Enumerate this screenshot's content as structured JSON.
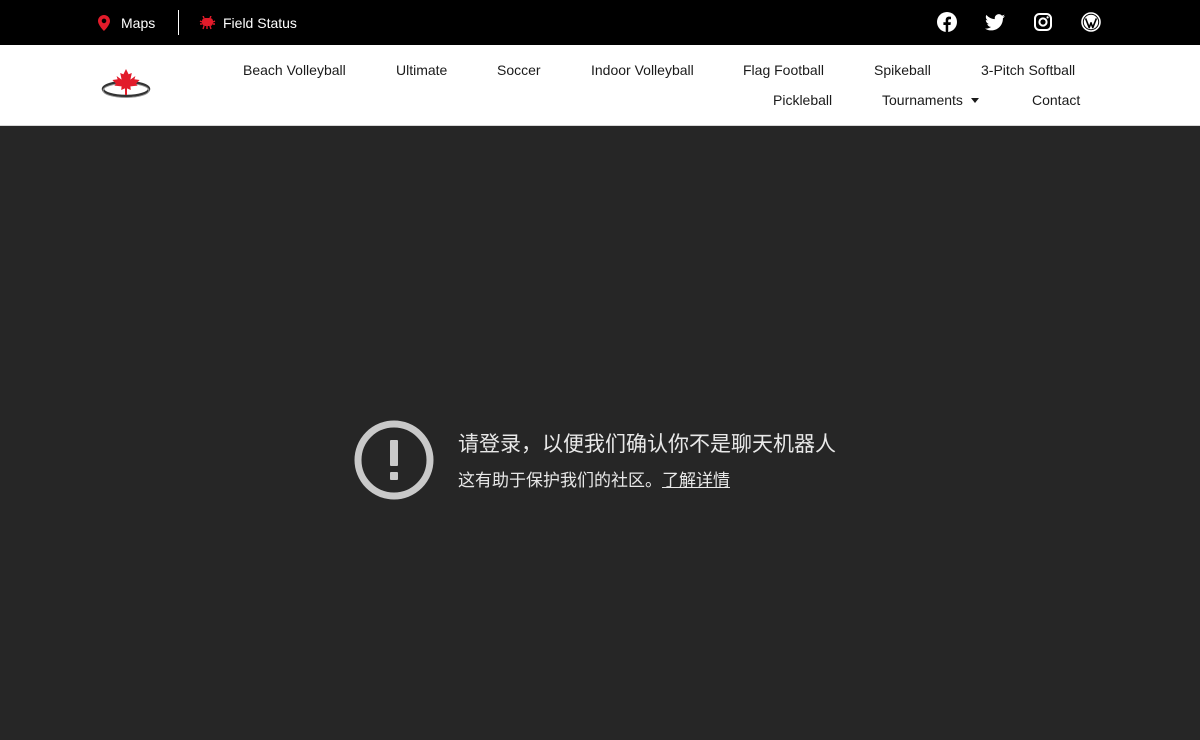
{
  "topbar": {
    "maps_label": "Maps",
    "field_status_label": "Field Status",
    "accent_color": "#e21b2a",
    "social_icons": [
      "facebook-icon",
      "twitter-icon",
      "instagram-icon",
      "wordpress-icon"
    ]
  },
  "nav": {
    "row1": [
      "Beach Volleyball",
      "Ultimate",
      "Soccer",
      "Indoor Volleyball",
      "Flag Football",
      "Spikeball",
      "3-Pitch Softball"
    ],
    "row2": [
      "Pickleball",
      "Tournaments",
      "Contact"
    ]
  },
  "notice": {
    "title": "请登录，以便我们确认你不是聊天机器人",
    "description": "这有助于保护我们的社区。",
    "link_label": "了解详情",
    "icon": "exclamation-circle-icon"
  }
}
